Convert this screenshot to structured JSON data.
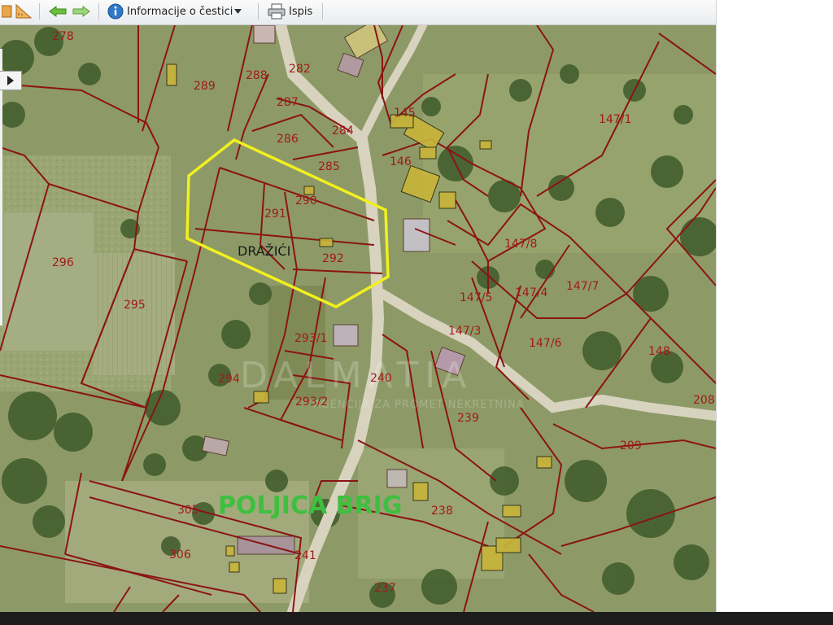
{
  "toolbar": {
    "info_label": "Informacije o čestici",
    "print_label": "Ispis"
  },
  "map": {
    "place_names": {
      "village": "DRAŽIĆI",
      "area": "POLJICA BRIG"
    },
    "watermark": {
      "brand": "DALMATIA",
      "tagline": "AGENCIJA ZA PROMET NEKRETNINA"
    },
    "parcels": {
      "p278": "278",
      "p289": "289",
      "p288": "288",
      "p282": "282",
      "p287": "287",
      "p286": "286",
      "p284": "284",
      "p285": "285",
      "p145": "145",
      "p146": "146",
      "p147_1": "147/1",
      "p290": "290",
      "p291": "291",
      "p292": "292",
      "p296": "296",
      "p295": "295",
      "p147_8": "147/8",
      "p147_4": "147/4",
      "p147_7": "147/7",
      "p147_5": "147/5",
      "p147_3": "147/3",
      "p147_6": "147/6",
      "p293_1": "293/1",
      "p148": "148",
      "p294": "294",
      "p240": "240",
      "p293_2": "293/2",
      "p239": "239",
      "p208": "208",
      "p209": "209",
      "p305": "305",
      "p238": "238",
      "p306": "306",
      "p241": "241",
      "p237": "237"
    },
    "colors": {
      "boundary": "#8b1414",
      "selection": "#f2f01e",
      "place_label": "#3fbf3f"
    }
  }
}
